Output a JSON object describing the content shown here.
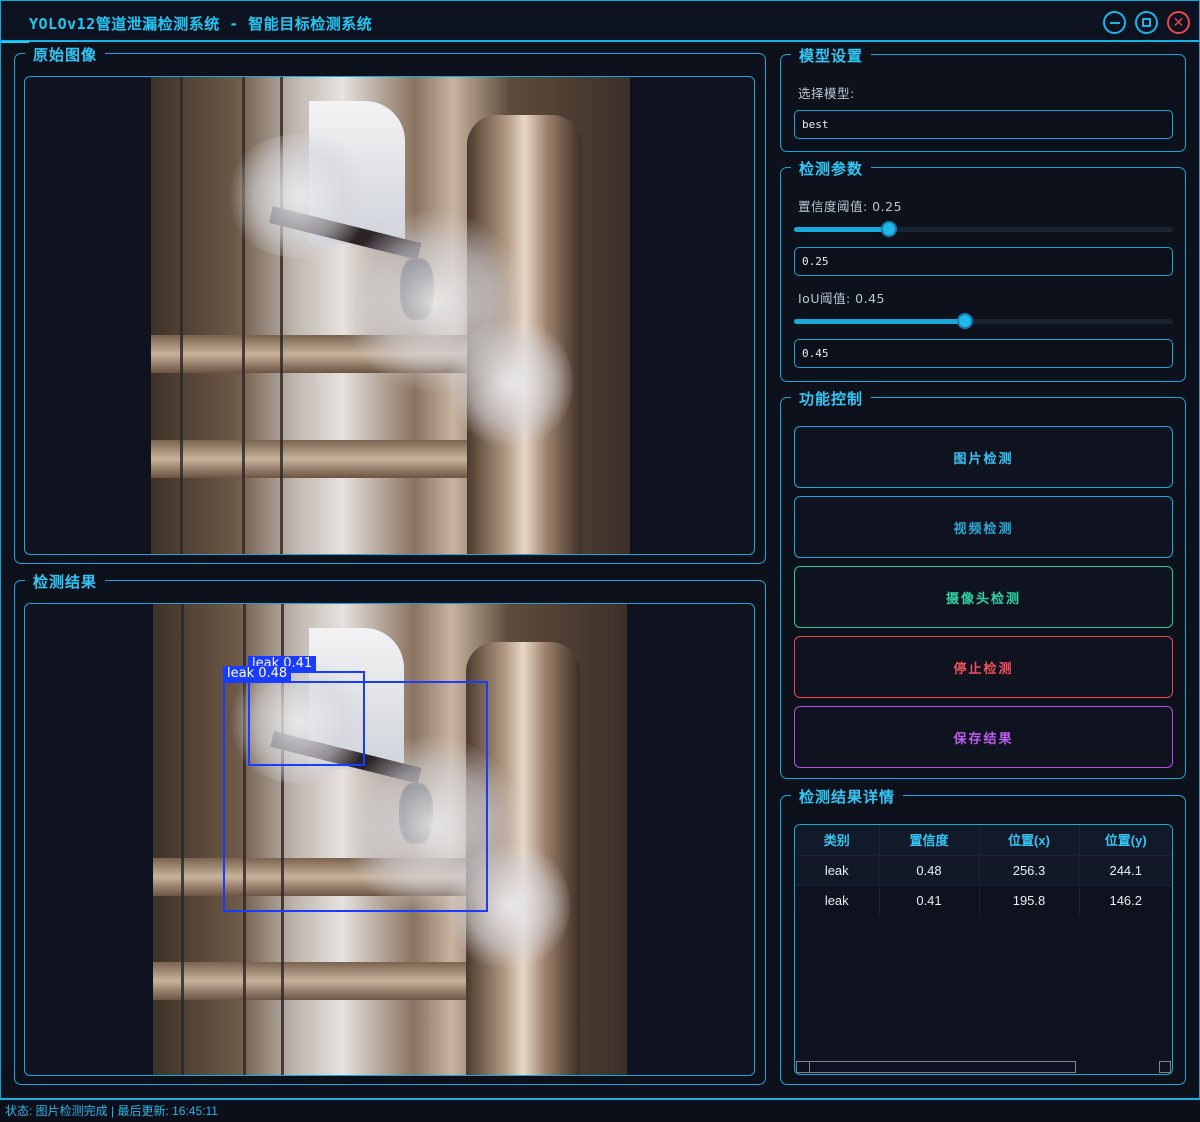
{
  "window": {
    "title": "YOLOv12管道泄漏检测系统 - 智能目标检测系统",
    "minimize_icon": "minimize-icon",
    "maximize_icon": "maximize-icon",
    "close_icon": "close-icon"
  },
  "original_panel": {
    "title": "原始图像"
  },
  "result_panel": {
    "title": "检测结果",
    "detections": [
      {
        "label": "leak 0.48"
      },
      {
        "label": "leak 0.41"
      }
    ]
  },
  "model_settings": {
    "title": "模型设置",
    "select_label": "选择模型:",
    "selected_model": "best"
  },
  "detection_params": {
    "title": "检测参数",
    "confidence_label": "置信度阈值: 0.25",
    "confidence_value": "0.25",
    "confidence_level": 0.25,
    "iou_label": "IoU阈值: 0.45",
    "iou_value": "0.45",
    "iou_level": 0.45
  },
  "function_control": {
    "title": "功能控制",
    "buttons": {
      "image": "图片检测",
      "video": "视频检测",
      "camera": "摄像头检测",
      "stop": "停止检测",
      "save": "保存结果"
    }
  },
  "results_detail": {
    "title": "检测结果详情",
    "columns": [
      "类别",
      "置信度",
      "位置(x)",
      "位置(y)"
    ],
    "rows": [
      [
        "leak",
        "0.48",
        "256.3",
        "244.1"
      ],
      [
        "leak",
        "0.41",
        "195.8",
        "146.2"
      ]
    ]
  },
  "status_bar": {
    "text": "状态: 图片检测完成 | 最后更新: 16:45:11"
  },
  "colors": {
    "accent": "#1aa6d8",
    "title": "#22c6f2",
    "detect_box": "#1a3cff",
    "image_btn": "#1aa6d8",
    "video_btn": "#1aa6d8",
    "camera_btn": "#27c79a",
    "stop_btn": "#e8474f",
    "save_btn": "#b34fe0"
  }
}
